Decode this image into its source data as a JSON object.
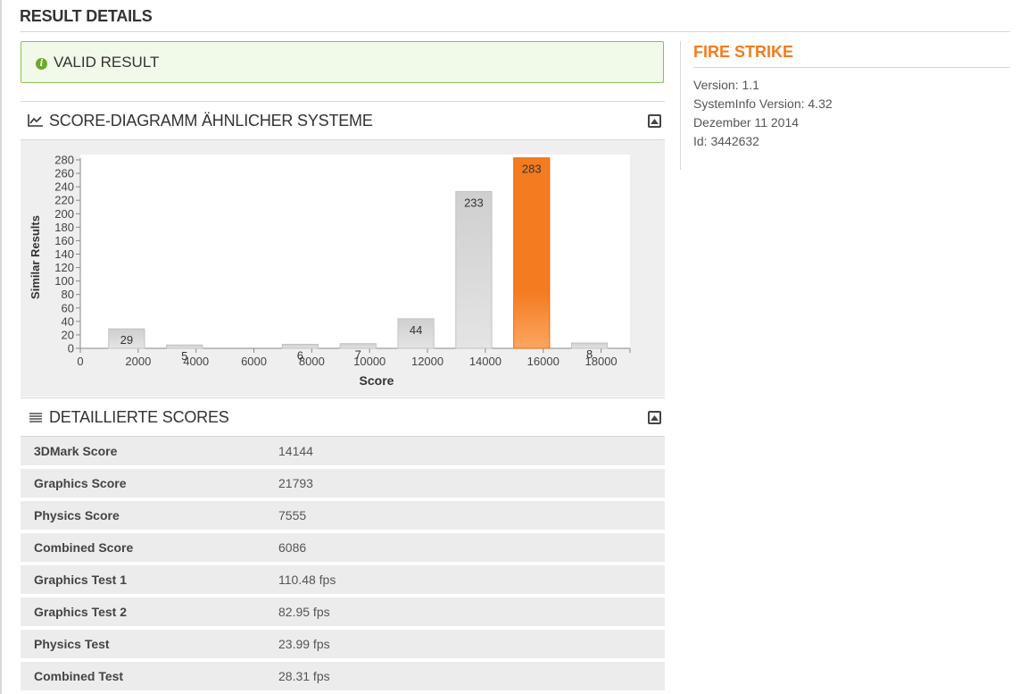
{
  "page": {
    "title": "RESULT DETAILS"
  },
  "status": {
    "label": "VALID RESULT",
    "color": "#8cc152"
  },
  "chart_section": {
    "title": "SCORE-DIAGRAMM ÄHNLICHER SYSTEME"
  },
  "chart_data": {
    "type": "bar",
    "xlabel": "Score",
    "ylabel": "Similar Results",
    "xlim": [
      0,
      19000
    ],
    "ylim": [
      0,
      280
    ],
    "xticks": [
      0,
      2000,
      4000,
      6000,
      8000,
      10000,
      12000,
      14000,
      16000,
      18000
    ],
    "yticks": [
      0,
      20,
      40,
      60,
      80,
      100,
      120,
      140,
      160,
      180,
      200,
      220,
      240,
      260,
      280
    ],
    "bars": [
      {
        "x": 1600,
        "value": 29,
        "label": "29"
      },
      {
        "x": 3600,
        "value": 5,
        "label": "5"
      },
      {
        "x": 7600,
        "value": 6,
        "label": "6"
      },
      {
        "x": 9600,
        "value": 7,
        "label": "7"
      },
      {
        "x": 11600,
        "value": 44,
        "label": "44"
      },
      {
        "x": 13600,
        "value": 233,
        "label": "233"
      },
      {
        "x": 15600,
        "value": 283,
        "label": "283",
        "highlight": true
      },
      {
        "x": 17600,
        "value": 8,
        "label": "8"
      }
    ],
    "bar_color": "#d0d0d0",
    "highlight_color": "#f47b20",
    "grid": false,
    "legend": "none"
  },
  "scores_section": {
    "title": "DETAILLIERTE SCORES",
    "rows": [
      {
        "label": "3DMark Score",
        "value": "14144"
      },
      {
        "label": "Graphics Score",
        "value": "21793"
      },
      {
        "label": "Physics Score",
        "value": "7555"
      },
      {
        "label": "Combined Score",
        "value": "6086"
      },
      {
        "label": "Graphics Test 1",
        "value": "110.48 fps"
      },
      {
        "label": "Graphics Test 2",
        "value": "82.95 fps"
      },
      {
        "label": "Physics Test",
        "value": "23.99 fps"
      },
      {
        "label": "Combined Test",
        "value": "28.31 fps"
      }
    ]
  },
  "sidebar": {
    "title": "FIRE STRIKE",
    "accent": "#f47b20",
    "lines": [
      "Version: 1.1",
      "SystemInfo Version: 4.32",
      "Dezember 11 2014",
      "Id: 3442632"
    ]
  }
}
